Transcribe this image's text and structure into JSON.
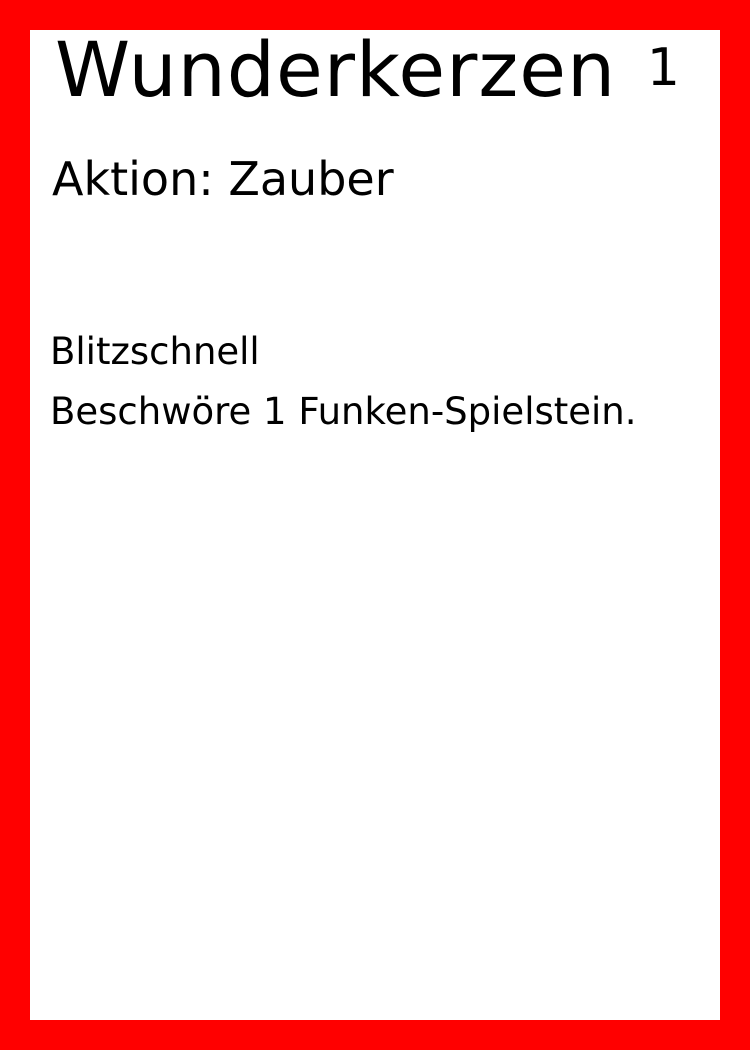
{
  "card": {
    "name": "Wunderkerzen",
    "cost": "1",
    "type_line": "Aktion: Zauber",
    "text": {
      "keyword": "Blitzschnell",
      "effect": "Beschwöre 1 Funken-Spielstein."
    },
    "border_color": "#ff0000",
    "background_color": "#ffffff",
    "text_color": "#000000"
  }
}
